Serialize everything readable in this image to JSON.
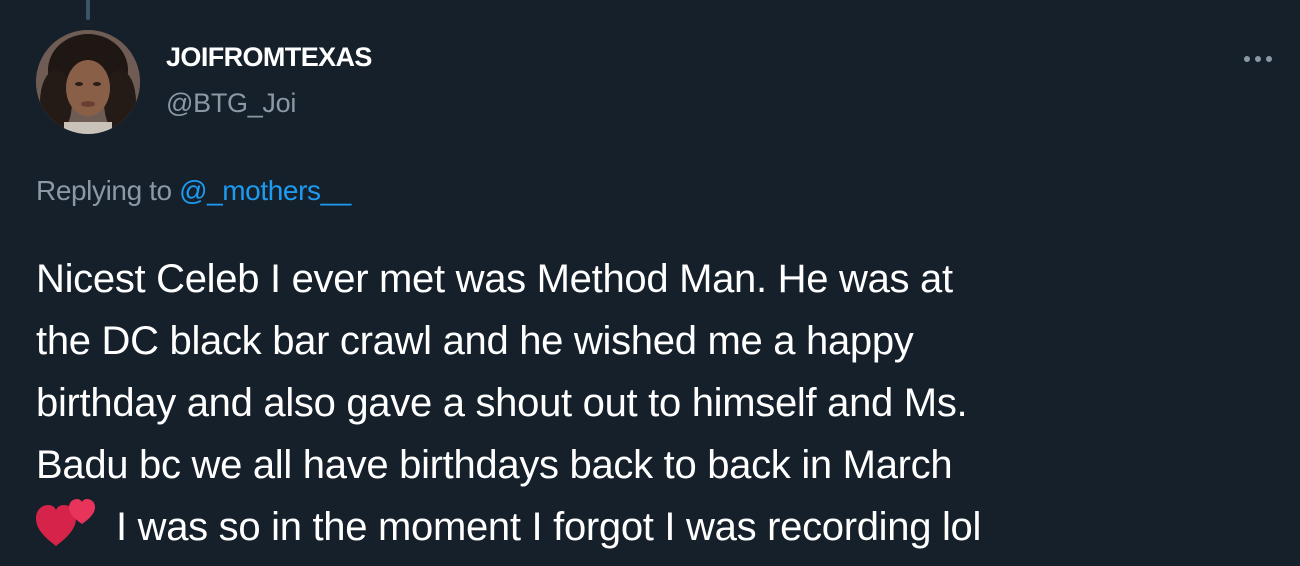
{
  "author": {
    "display_name": "JOIFROMTEXAS",
    "handle": "@BTG_Joi",
    "avatar_icon": "user-avatar"
  },
  "more_menu": {
    "icon": "more-horizontal-icon"
  },
  "reply_context": {
    "prefix": "Replying to ",
    "mention": "@_mothers__"
  },
  "tweet": {
    "lines": [
      "Nicest Celeb I ever met was Method Man. He was at",
      "the DC black bar crawl and he wished me a happy",
      "birthday and also gave a shout out to himself and Ms.",
      "Badu bc we all have birthdays back to back in March"
    ],
    "emoji_icon": "two-hearts-icon",
    "last_line": "I was so in the moment I forgot I was recording lol"
  },
  "colors": {
    "background": "#15202b",
    "text_primary": "#ffffff",
    "text_secondary": "#8b98a5",
    "link": "#1d9bf0"
  }
}
